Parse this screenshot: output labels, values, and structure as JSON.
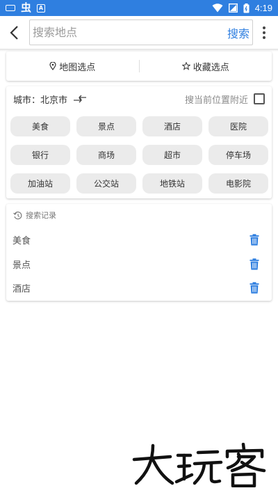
{
  "status_bar": {
    "time": "4:19",
    "app_icon_letter": "A",
    "colors": {
      "background": "#2f7fe0"
    }
  },
  "header": {
    "search_placeholder": "搜索地点",
    "search_button": "搜索",
    "icons": [
      "back-arrow-icon",
      "more-vert-icon"
    ]
  },
  "pick_options": [
    {
      "label": "地图选点",
      "icon": "location-pin-icon"
    },
    {
      "label": "收藏选点",
      "icon": "star-icon"
    }
  ],
  "city": {
    "label": "城市：北京市",
    "nearby_label": "搜当前位置附近",
    "nearby_checked": false
  },
  "categories": [
    "美食",
    "景点",
    "酒店",
    "医院",
    "银行",
    "商场",
    "超市",
    "停车场",
    "加油站",
    "公交站",
    "地铁站",
    "电影院"
  ],
  "history": {
    "title": "搜索记录",
    "items": [
      "美食",
      "景点",
      "酒店"
    ]
  },
  "watermark": {
    "text": "大玩客"
  },
  "colors": {
    "accent": "#2f7fe0",
    "chip_bg": "#ebebeb"
  }
}
